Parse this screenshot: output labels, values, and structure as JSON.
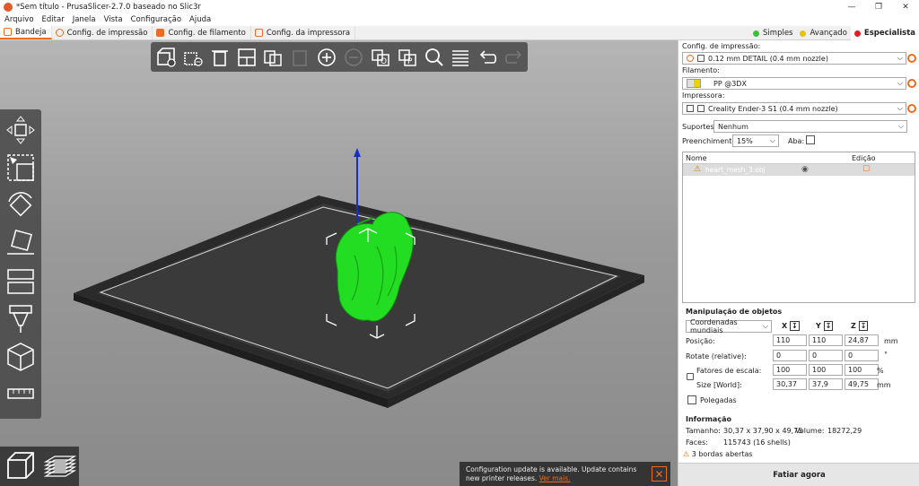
{
  "window": {
    "title": "*Sem título - PrusaSlicer-2.7.0 baseado no Slic3r",
    "controls": [
      "—",
      "❐",
      "✕"
    ]
  },
  "menu": [
    "Arquivo",
    "Editar",
    "Janela",
    "Vista",
    "Configuração",
    "Ajuda"
  ],
  "tabs": [
    {
      "label": "Bandeja",
      "color": "#ed6b21"
    },
    {
      "label": "Config. de impressão",
      "color": "#ed6b21"
    },
    {
      "label": "Config. de filamento",
      "color": "#ed6b21"
    },
    {
      "label": "Config. da impressora",
      "color": "#ed6b21"
    }
  ],
  "modes": [
    {
      "label": "Simples",
      "color": "#3cc03c"
    },
    {
      "label": "Avançado",
      "color": "#e8c20c"
    },
    {
      "label": "Especialista",
      "color": "#e02020"
    }
  ],
  "sidebar": {
    "print_settings_label": "Config. de impressão:",
    "print_settings_value": "0.12 mm DETAIL (0.4 mm nozzle)",
    "filament_label": "Filamento:",
    "filament_value": "PP @3DX",
    "printer_label": "Impressora:",
    "printer_value": "Creality Ender-3 S1 (0.4 mm nozzle)",
    "supports_label": "Suportes:",
    "supports_value": "Nenhum",
    "infill_label": "Preenchimento:",
    "infill_value": "15%",
    "brim_label": "Aba:",
    "list_header_name": "Nome",
    "list_header_edit": "Edição",
    "object_name": "heart_mesh_3.obj",
    "manip_title": "Manipulação de objetos",
    "coord_system": "Coordenadas mundiais",
    "axis_x": "X",
    "axis_y": "Y",
    "axis_z": "Z",
    "position_label": "Posição:",
    "position": [
      "110",
      "110",
      "24,87"
    ],
    "position_unit": "mm",
    "rotate_label": "Rotate (relative):",
    "rotate": [
      "0",
      "0",
      "0"
    ],
    "rotate_unit": "°",
    "scale_label": "Fatores de escala:",
    "scale": [
      "100",
      "100",
      "100"
    ],
    "scale_unit": "%",
    "size_label": "Size [World]:",
    "size": [
      "30,37",
      "37,9",
      "49,75"
    ],
    "size_unit": "mm",
    "inches_label": "Polegadas",
    "info_title": "Informação",
    "size_info_label": "Tamanho:",
    "size_info_value": "30,37 x 37,90 x 49,75",
    "volume_label": "Volume:",
    "volume_value": "18272,29",
    "faces_label": "Faces:",
    "faces_value": "115743 (16 shells)",
    "warning_text": "3 bordas abertas",
    "slice_button": "Fatiar agora"
  },
  "notification": {
    "text": "Configuration update is available. Update contains new printer releases.",
    "link": "Ver mais."
  }
}
